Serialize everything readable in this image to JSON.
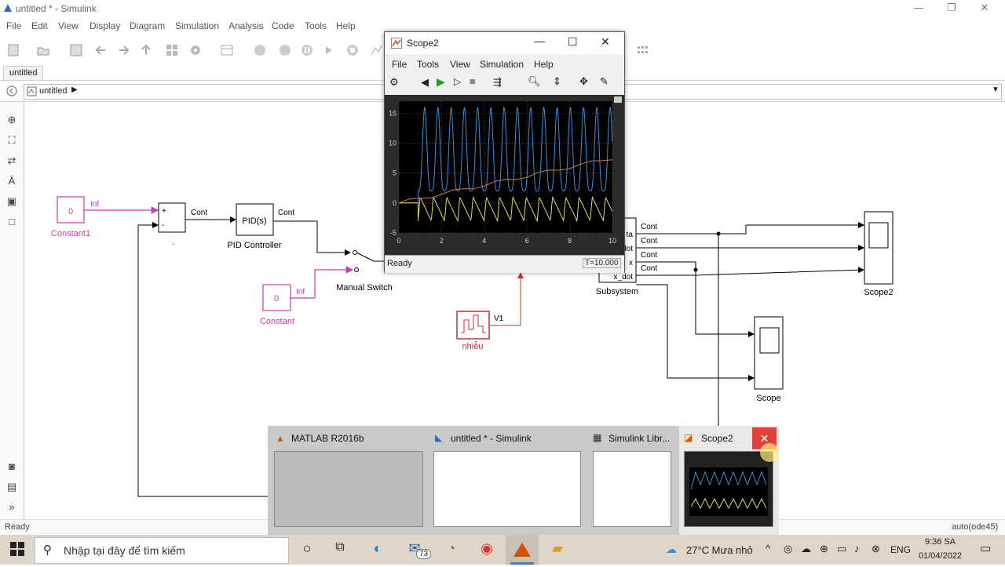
{
  "window": {
    "title": "untitled * - Simulink",
    "menu": [
      "File",
      "Edit",
      "View",
      "Display",
      "Diagram",
      "Simulation",
      "Analysis",
      "Code",
      "Tools",
      "Help"
    ],
    "tab": "untitled",
    "breadcrumb": "untitled"
  },
  "diagram": {
    "constant1": {
      "value": "0",
      "name": "Constant1",
      "signal": "Inf"
    },
    "constant": {
      "value": "0",
      "name": "Constant",
      "signal": "Inf"
    },
    "sum": {
      "plus": "+",
      "minus": "-",
      "output": "Cont"
    },
    "pid": {
      "label": "PID(s)",
      "name": "PID Controller",
      "output": "Cont"
    },
    "manual_switch": {
      "name": "Manual Switch"
    },
    "noise": {
      "name": "nhiễu",
      "output": "V1"
    },
    "subsystem": {
      "name": "Subsystem",
      "ports": [
        "ta",
        "dot",
        "x",
        "x_dot"
      ],
      "outputs": [
        "Cont",
        "Cont",
        "Cont",
        "Cont"
      ]
    },
    "scope2": {
      "name": "Scope2"
    },
    "scope": {
      "name": "Scope"
    },
    "dot_label": "."
  },
  "scope_window": {
    "title": "Scope2",
    "menu": [
      "File",
      "Tools",
      "View",
      "Simulation",
      "Help"
    ],
    "status": "Ready",
    "time": "T=10.000",
    "y_ticks": [
      "15",
      "10",
      "5",
      "0",
      "-5"
    ],
    "x_ticks": [
      "0",
      "2",
      "4",
      "6",
      "8",
      "10"
    ],
    "colors": {
      "series1": "#3b8fd6",
      "series2": "#e6d86a",
      "series3": "#d87a4a",
      "background": "#000000"
    }
  },
  "chart_data": {
    "type": "line",
    "xlim": [
      0,
      10
    ],
    "ylim": [
      -5,
      17
    ],
    "grid": true,
    "series": [
      {
        "color": "#3b8fd6",
        "peak": 16,
        "trough": 2,
        "period": 0.62,
        "start": 0.9
      },
      {
        "color": "#e6d86a",
        "peak": 1,
        "trough": -3,
        "period": 0.62,
        "start": 0.9
      },
      {
        "color": "#d87a4a",
        "from": [
          0,
          0
        ],
        "to": [
          10,
          7.5
        ]
      }
    ]
  },
  "statusbar": {
    "left": "Ready",
    "right": "auto(ode45)"
  },
  "thumbnails": [
    {
      "title": "MATLAB R2016b"
    },
    {
      "title": "untitled * - Simulink"
    },
    {
      "title": "Simulink Libr..."
    },
    {
      "title": "Scope2"
    }
  ],
  "taskbar": {
    "search_placeholder": "Nhập tại đây để tìm kiếm",
    "mail_badge": "73",
    "weather": "27°C  Mưa nhỏ",
    "lang": "ENG",
    "time": "9:36 SA",
    "date": "01/04/2022"
  }
}
